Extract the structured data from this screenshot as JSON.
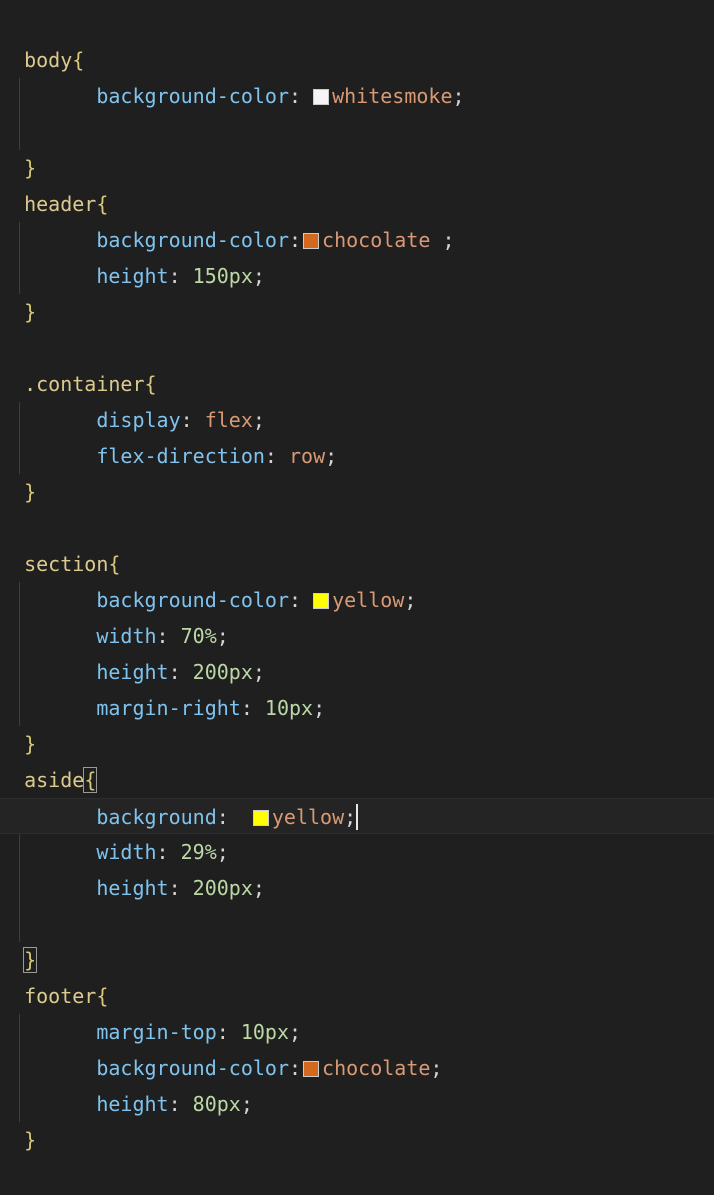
{
  "code": {
    "body_sel": "body",
    "body_open": "{",
    "body_bg_prop": "background-color",
    "body_bg_val": "whitesmoke",
    "body_close": "}",
    "header_sel": "header",
    "header_open": "{",
    "header_bg_prop": "background-color",
    "header_bg_val": "chocolate",
    "header_h_prop": "height",
    "header_h_val": "150px",
    "header_close": "}",
    "container_sel": ".container",
    "container_open": "{",
    "container_disp_prop": "display",
    "container_disp_val": "flex",
    "container_fd_prop": "flex-direction",
    "container_fd_val": "row",
    "container_close": "}",
    "section_sel": "section",
    "section_open": "{",
    "section_bg_prop": "background-color",
    "section_bg_val": "yellow",
    "section_w_prop": "width",
    "section_w_val": "70%",
    "section_h_prop": "height",
    "section_h_val": "200px",
    "section_mr_prop": "margin-right",
    "section_mr_val": "10px",
    "section_close": "}",
    "aside_sel": "aside",
    "aside_open": "{",
    "aside_bg_prop": "background",
    "aside_bg_val": "yellow",
    "aside_w_prop": "width",
    "aside_w_val": "29%",
    "aside_h_prop": "height",
    "aside_h_val": "200px",
    "aside_close": "}",
    "footer_sel": "footer",
    "footer_open": "{",
    "footer_mt_prop": "margin-top",
    "footer_mt_val": "10px",
    "footer_bg_prop": "background-color",
    "footer_bg_val": "chocolate",
    "footer_h_prop": "height",
    "footer_h_val": "80px",
    "footer_close": "}",
    "colon": ":",
    "semicolon": ";",
    "space_semicolon": " ;"
  },
  "colors": {
    "background": "#1f1f1f",
    "selector": "#dccb8f",
    "property": "#7fc3ee",
    "keyword": "#d89a74",
    "number": "#bcd8a6",
    "swatch_whitesmoke": "#f5f5f5",
    "swatch_chocolate": "#d2691e",
    "swatch_yellow": "#ffff00"
  }
}
